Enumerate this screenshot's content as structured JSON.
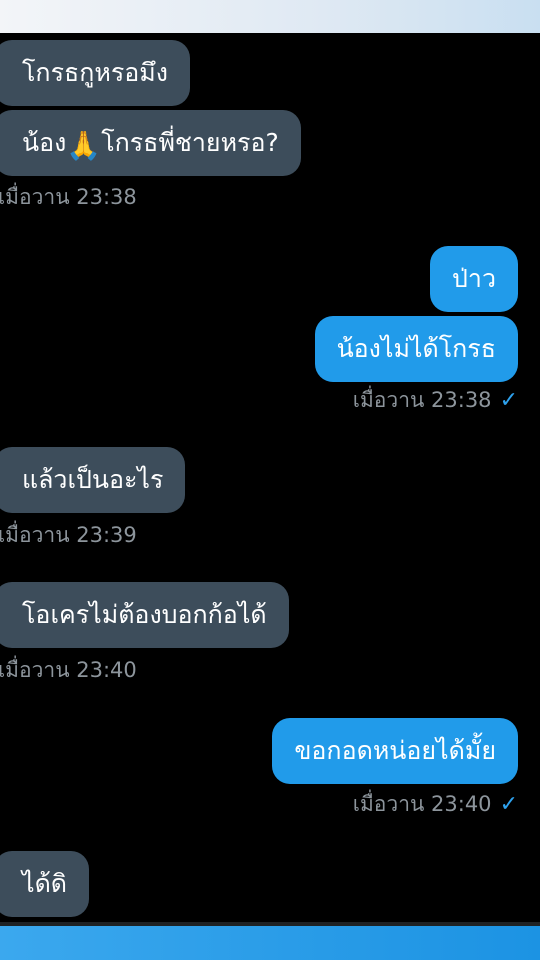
{
  "messages": [
    {
      "direction": "in",
      "text": "โกรธกูหรอมึง"
    },
    {
      "direction": "in",
      "text_before": "น้อง",
      "emoji_name": "folded-hands-emoji",
      "emoji": "🙏",
      "text_after": "โกรธพี่ชายหรอ?",
      "time": "เมื่อวาน 23:38"
    },
    {
      "direction": "out",
      "text": "ป่าว"
    },
    {
      "direction": "out",
      "text": "น้องไม่ได้โกรธ",
      "time": "เมื่อวาน 23:38",
      "status": "✓"
    },
    {
      "direction": "in",
      "text": "แล้วเป็นอะไร",
      "time": "เมื่อวาน 23:39"
    },
    {
      "direction": "in",
      "text": "โอเครไม่ต้องบอกก้อได้",
      "time": "เมื่อวาน 23:40"
    },
    {
      "direction": "out",
      "text": "ขอกอดหน่อยได้มั้ย",
      "time": "เมื่อวาน 23:40",
      "status": "✓"
    },
    {
      "direction": "in",
      "text": "ได้ดิ"
    }
  ],
  "colors": {
    "background": "#000000",
    "incoming_bubble": "#3d4d5b",
    "outgoing_bubble": "#219bea",
    "timestamp": "#8d959c",
    "read_check": "#2ea2ee",
    "bottom_bar": "#2b9de8"
  }
}
